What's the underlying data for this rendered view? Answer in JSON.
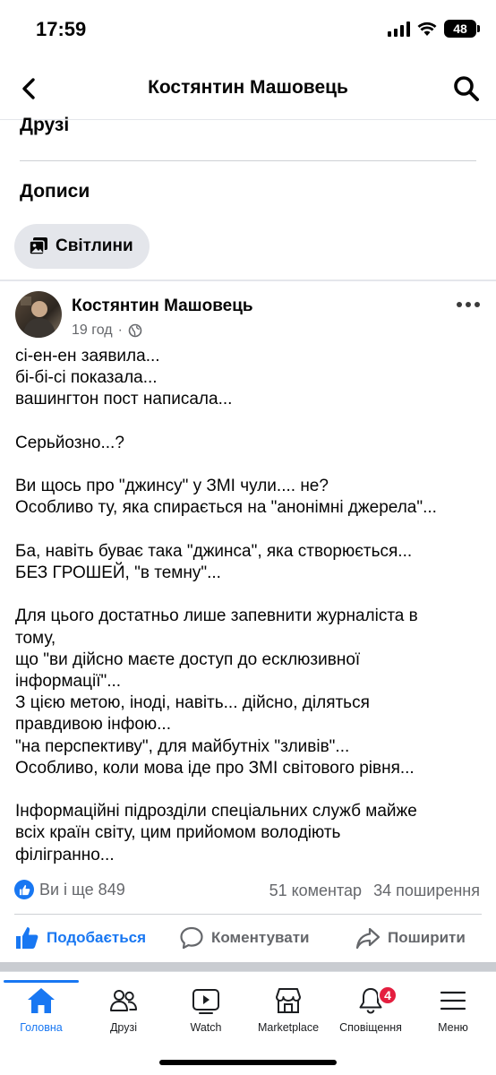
{
  "status_bar": {
    "time": "17:59",
    "battery": "48"
  },
  "header": {
    "title": "Костянтин Машовець"
  },
  "profile": {
    "friends_heading": "Друзі",
    "posts_heading": "Дописи",
    "photos_chip": "Світлини"
  },
  "post": {
    "author": "Костянтин Машовець",
    "time": "19 год",
    "separator": "·",
    "body_lines": [
      "сі-ен-ен заявила...",
      "бі-бі-сі показала...",
      "вашингтон пост написала...",
      "",
      "Серьйозно...?",
      "",
      "Ви щось про \"джинсу\" у ЗМІ чули.... не?",
      "Особливо ту, яка спирається на \"анонімні джерела\"...",
      "",
      "Ба, навіть буває така \"джинса\", яка створюється...",
      "БЕЗ ГРОШЕЙ, \"в темну\"...",
      "",
      "Для цього достатньо лише запевнити журналіста в",
      "тому,",
      "що \"ви дійсно маєте доступ до есклюзивної",
      "інформації\"...",
      "З цією метою, іноді, навіть... дійсно, діляться",
      "правдивою інфою...",
      "\"на перспективу\", для майбутніх \"зливів\"...",
      "Особливо, коли мова іде про ЗМІ світового рівня...",
      "",
      "Інформаційні підрозділи спеціальних служб майже",
      "всіх країн світу, цим прийомом володіють",
      "філігранно..."
    ],
    "reactions_text": "Ви і ще 849",
    "comments_count": "51 коментар",
    "shares_count": "34 поширення",
    "actions": {
      "like": "Подобається",
      "comment": "Коментувати",
      "share": "Поширити"
    }
  },
  "tabs": [
    {
      "label": "Головна",
      "icon": "home-icon"
    },
    {
      "label": "Друзі",
      "icon": "friends-icon"
    },
    {
      "label": "Watch",
      "icon": "watch-icon"
    },
    {
      "label": "Marketplace",
      "icon": "marketplace-icon"
    },
    {
      "label": "Сповіщення",
      "icon": "bell-icon",
      "badge": "4"
    },
    {
      "label": "Меню",
      "icon": "menu-icon"
    }
  ],
  "colors": {
    "accent": "#1877f2",
    "badge": "#e41e3f",
    "secondary_text": "#65676b"
  }
}
